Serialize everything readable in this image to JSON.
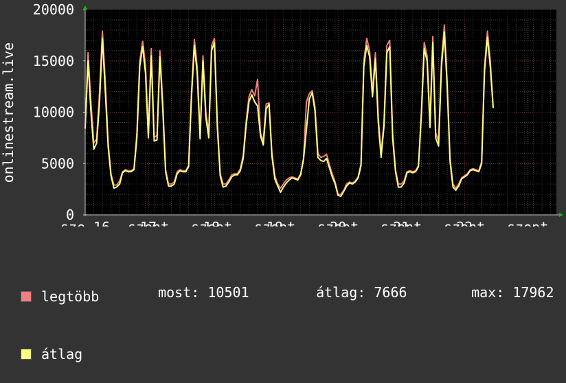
{
  "chart_data": {
    "type": "line",
    "ylabel": "onlinestream.live",
    "ylim": [
      0,
      20000
    ],
    "yticks": [
      0,
      5000,
      10000,
      15000,
      20000
    ],
    "xlim": [
      0,
      164
    ],
    "xticks": [
      {
        "x": 0,
        "label": "sze 16"
      },
      {
        "x": 22,
        "label": "szept"
      },
      {
        "x": 22,
        "label": "17"
      },
      {
        "x": 44,
        "label": "szept"
      },
      {
        "x": 44,
        "label": "18"
      },
      {
        "x": 66,
        "label": "szept"
      },
      {
        "x": 66,
        "label": "19"
      },
      {
        "x": 88,
        "label": "szept"
      },
      {
        "x": 88,
        "label": "20"
      },
      {
        "x": 110,
        "label": "szept"
      },
      {
        "x": 110,
        "label": "21"
      },
      {
        "x": 132,
        "label": "szept"
      },
      {
        "x": 132,
        "label": "22"
      },
      {
        "x": 154,
        "label": "szept"
      }
    ],
    "grid": true,
    "series": [
      {
        "name": "legtöbb",
        "color": "#f08080",
        "values": [
          8600,
          15800,
          11000,
          7000,
          7400,
          12000,
          17900,
          13000,
          7000,
          4000,
          2900,
          2900,
          3300,
          4200,
          4400,
          4300,
          4300,
          4500,
          8000,
          15000,
          16900,
          14600,
          8000,
          16200,
          7600,
          7700,
          16000,
          11000,
          4400,
          3000,
          3000,
          3200,
          4200,
          4400,
          4300,
          4300,
          4800,
          12000,
          17100,
          14400,
          7900,
          15500,
          10000,
          8000,
          16500,
          17200,
          9000,
          4000,
          3000,
          3000,
          3400,
          3900,
          4000,
          4000,
          4500,
          5800,
          9000,
          11500,
          12200,
          11600,
          13200,
          8000,
          7200,
          10800,
          10900,
          6000,
          3800,
          3000,
          2600,
          3000,
          3400,
          3600,
          3700,
          3600,
          3500,
          4000,
          5500,
          11000,
          11800,
          12100,
          10500,
          6000,
          5600,
          5700,
          5900,
          4900,
          4000,
          3200,
          2000,
          2000,
          2400,
          3000,
          3200,
          3100,
          3300,
          3700,
          5000,
          15000,
          17200,
          16000,
          12000,
          15800,
          9500,
          6000,
          9000,
          16500,
          17000,
          8000,
          4400,
          3000,
          3000,
          3300,
          4200,
          4300,
          4200,
          4300,
          4800,
          10000,
          16800,
          15500,
          9000,
          17400,
          8000,
          7200,
          15000,
          18500,
          13000,
          5500,
          3000,
          2600,
          3000,
          3600,
          3800,
          4000,
          4400,
          4500,
          4400,
          4300,
          5200,
          14500,
          17900,
          15000,
          10500
        ]
      },
      {
        "name": "átlag",
        "color": "#ffff80",
        "values": [
          8400,
          15000,
          10000,
          6400,
          7000,
          11000,
          17200,
          12000,
          6600,
          3800,
          2600,
          2700,
          3000,
          4100,
          4300,
          4200,
          4200,
          4400,
          7500,
          14500,
          16400,
          13800,
          7500,
          15500,
          7200,
          7300,
          15400,
          10400,
          4200,
          2800,
          2800,
          3000,
          4000,
          4300,
          4200,
          4200,
          4700,
          11500,
          16500,
          13800,
          7400,
          15000,
          9500,
          7500,
          16000,
          16800,
          8500,
          3800,
          2700,
          2800,
          3200,
          3700,
          3900,
          3900,
          4300,
          5500,
          8600,
          11000,
          11700,
          11000,
          10600,
          7700,
          6800,
          10300,
          10800,
          5700,
          3500,
          2800,
          2200,
          2700,
          3100,
          3400,
          3600,
          3500,
          3400,
          3900,
          5400,
          8300,
          11300,
          11900,
          10100,
          5600,
          5300,
          5200,
          5500,
          4600,
          3700,
          3000,
          1900,
          1800,
          2300,
          2800,
          3100,
          3000,
          3200,
          3600,
          4800,
          14500,
          16500,
          15400,
          11500,
          15200,
          9000,
          5600,
          8600,
          15800,
          16400,
          7500,
          4200,
          2700,
          2700,
          3100,
          4100,
          4200,
          4100,
          4200,
          4700,
          9600,
          16200,
          15000,
          8500,
          16800,
          7500,
          6700,
          14400,
          17800,
          12500,
          5200,
          2700,
          2400,
          2800,
          3500,
          3700,
          3900,
          4300,
          4400,
          4300,
          4200,
          5000,
          14000,
          17300,
          14400,
          10400
        ]
      }
    ],
    "legend_labels": [
      "legtöbb",
      "átlag"
    ],
    "stats": {
      "most_label": "most:",
      "most_value": "10501",
      "atlag_label": "átlag:",
      "atlag_value": "7666",
      "max_label": "max:",
      "max_value": "17962"
    }
  }
}
